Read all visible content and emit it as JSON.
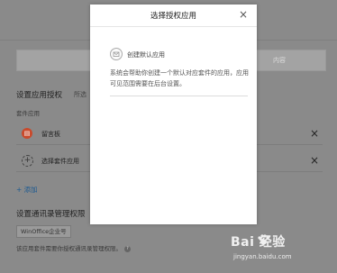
{
  "tabs": {
    "left_label": "1",
    "right_label": "内容"
  },
  "authorization_section": {
    "title": "设置应用授权",
    "hint": "所选",
    "suite_apps_label": "套件应用",
    "rows": [
      {
        "label": "留言板",
        "icon": "message-board-icon",
        "icon_glyph": "▤",
        "remove": "×"
      },
      {
        "label": "选择套件应用",
        "icon": "plus-circle-icon",
        "icon_glyph": "+",
        "remove": "×"
      }
    ],
    "add_link": "+ 添加"
  },
  "contacts_section": {
    "title": "设置通讯录管理权限",
    "tag": "WinOffice企业号",
    "note": "该应用套件需要你授权通讯录管理权限。"
  },
  "modal": {
    "title": "选择授权应用",
    "close_glyph": "×",
    "app_name": "创建默认应用",
    "description": "系统会帮助你创建一个默认对应套件的应用，应用可见范围需要在后台设置。"
  },
  "watermark": {
    "brand": "Bai  经验",
    "url": "jingyan.baidu.com"
  },
  "colors": {
    "overlay_bg": "#8a8a8a",
    "modal_bg": "#ffffff",
    "link_blue": "#1d5a91",
    "app_icon_red": "#c94a2c"
  }
}
